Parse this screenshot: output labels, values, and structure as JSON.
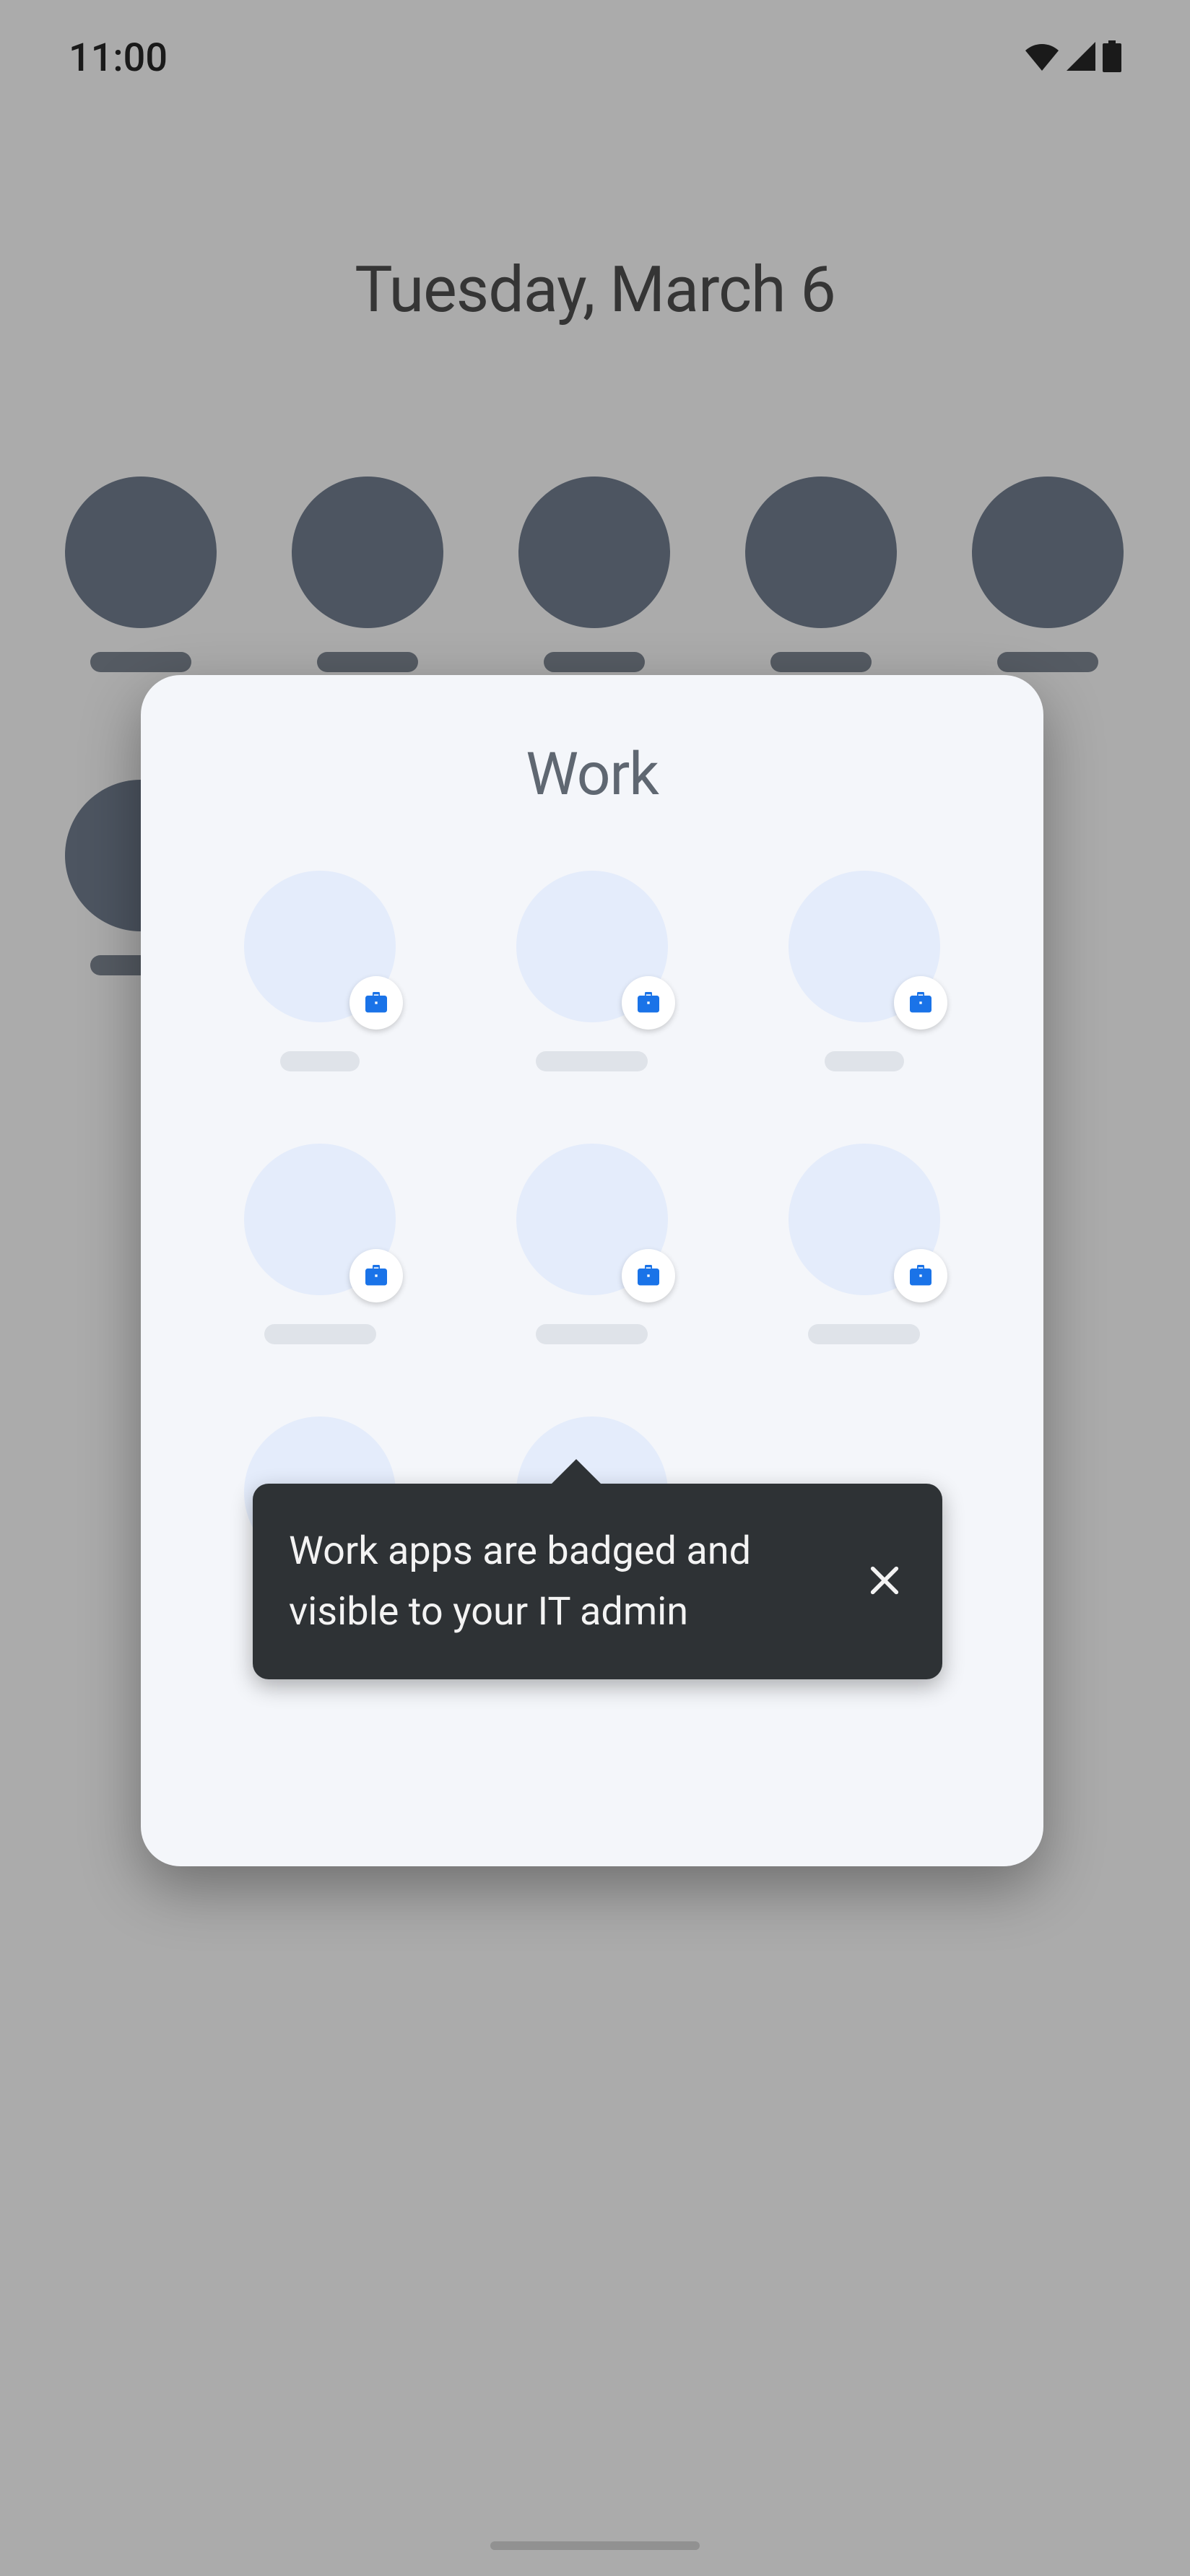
{
  "status": {
    "time": "11:00"
  },
  "home": {
    "date": "Tuesday, March 6"
  },
  "modal": {
    "title": "Work"
  },
  "tooltip": {
    "text": "Work apps are badged and visible to your IT admin"
  }
}
